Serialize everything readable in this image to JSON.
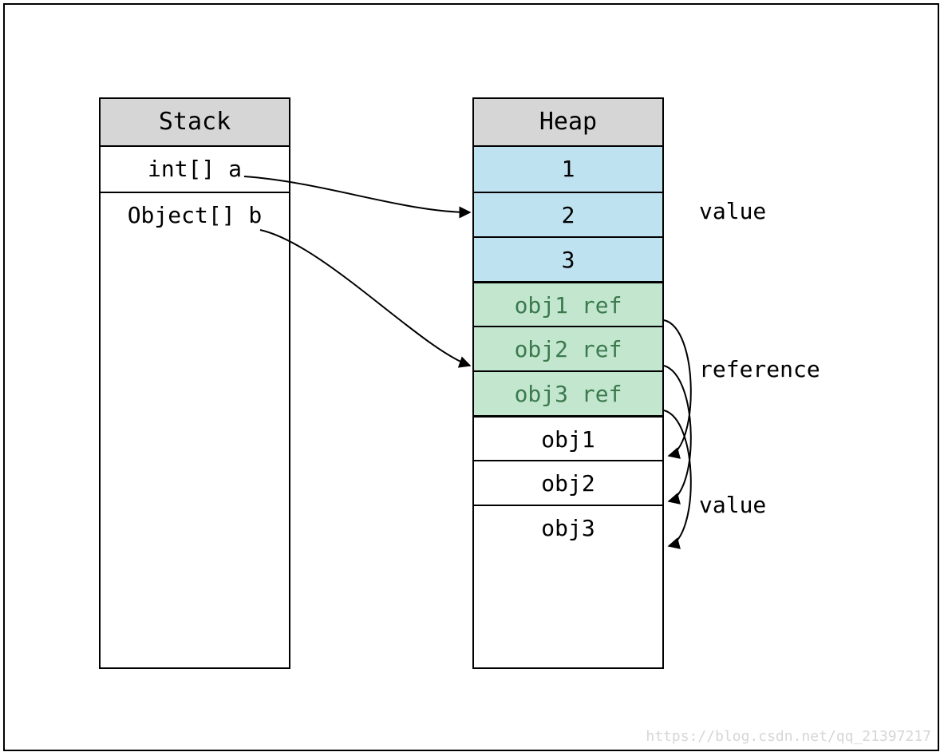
{
  "stack": {
    "title": "Stack",
    "items": [
      "int[] a",
      "Object[] b"
    ]
  },
  "heap": {
    "title": "Heap",
    "int_values": [
      "1",
      "2",
      "3"
    ],
    "refs": [
      "obj1 ref",
      "obj2 ref",
      "obj3 ref"
    ],
    "objects": [
      "obj1",
      "obj2",
      "obj3"
    ]
  },
  "labels": {
    "value_top": "value",
    "reference": "reference",
    "value_bottom": "value"
  },
  "watermark": "https://blog.csdn.net/qq_21397217"
}
